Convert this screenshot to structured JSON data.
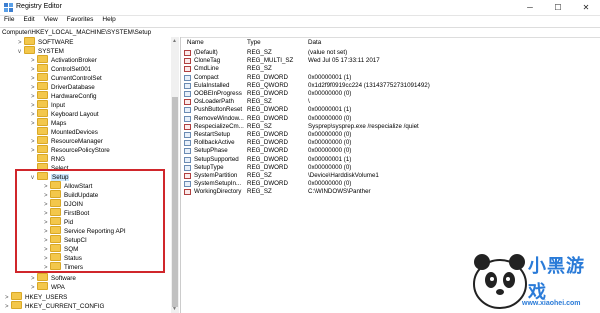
{
  "window": {
    "title": "Registry Editor",
    "minimize": "─",
    "maximize": "☐",
    "close": "✕"
  },
  "menu": [
    "File",
    "Edit",
    "View",
    "Favorites",
    "Help"
  ],
  "address": "Computer\\HKEY_LOCAL_MACHINE\\SYSTEM\\Setup",
  "tree": [
    {
      "label": "SOFTWARE",
      "exp": ">"
    },
    {
      "label": "SYSTEM",
      "exp": "v"
    },
    {
      "label": "ActivationBroker",
      "exp": ">"
    },
    {
      "label": "ControlSet001",
      "exp": ">"
    },
    {
      "label": "CurrentControlSet",
      "exp": ">"
    },
    {
      "label": "DriverDatabase",
      "exp": ">"
    },
    {
      "label": "HardwareConfig",
      "exp": ">"
    },
    {
      "label": "Input",
      "exp": ">"
    },
    {
      "label": "Keyboard Layout",
      "exp": ">"
    },
    {
      "label": "Maps",
      "exp": ">"
    },
    {
      "label": "MountedDevices",
      "exp": ""
    },
    {
      "label": "ResourceManager",
      "exp": ">"
    },
    {
      "label": "ResourcePolicyStore",
      "exp": ">"
    },
    {
      "label": "RNG",
      "exp": ""
    },
    {
      "label": "Select",
      "exp": ""
    },
    {
      "label": "Setup",
      "exp": "v"
    },
    {
      "label": "AllowStart",
      "exp": ">"
    },
    {
      "label": "BuildUpdate",
      "exp": ">"
    },
    {
      "label": "DJOIN",
      "exp": ">"
    },
    {
      "label": "FirstBoot",
      "exp": ">"
    },
    {
      "label": "Pid",
      "exp": ">"
    },
    {
      "label": "Service Reporting API",
      "exp": ">"
    },
    {
      "label": "SetupCI",
      "exp": ">"
    },
    {
      "label": "SQM",
      "exp": ">"
    },
    {
      "label": "Status",
      "exp": ">"
    },
    {
      "label": "Timers",
      "exp": ">"
    },
    {
      "label": "Software",
      "exp": ">"
    },
    {
      "label": "WPA",
      "exp": ">"
    },
    {
      "label": "HKEY_USERS",
      "exp": ">"
    },
    {
      "label": "HKEY_CURRENT_CONFIG",
      "exp": ">"
    }
  ],
  "columns": {
    "name": "Name",
    "type": "Type",
    "data": "Data"
  },
  "values": [
    {
      "name": "(Default)",
      "type": "REG_SZ",
      "data": "(value not set)",
      "icon": "ab"
    },
    {
      "name": "CloneTag",
      "type": "REG_MULTI_SZ",
      "data": "Wed Jul 05 17:33:11 2017",
      "icon": "ab"
    },
    {
      "name": "CmdLine",
      "type": "REG_SZ",
      "data": "",
      "icon": "ab"
    },
    {
      "name": "Compact",
      "type": "REG_DWORD",
      "data": "0x00000001 (1)",
      "icon": "bin"
    },
    {
      "name": "EulaInstalled",
      "type": "REG_QWORD",
      "data": "0x1d2f9f0919cc224 (131437752731091492)",
      "icon": "bin"
    },
    {
      "name": "OOBEInProgress",
      "type": "REG_DWORD",
      "data": "0x00000000 (0)",
      "icon": "bin"
    },
    {
      "name": "OsLoaderPath",
      "type": "REG_SZ",
      "data": "\\",
      "icon": "ab"
    },
    {
      "name": "PushButtonReset",
      "type": "REG_DWORD",
      "data": "0x00000001 (1)",
      "icon": "bin"
    },
    {
      "name": "RemoveWindow...",
      "type": "REG_DWORD",
      "data": "0x00000000 (0)",
      "icon": "bin"
    },
    {
      "name": "RespecializeCm...",
      "type": "REG_SZ",
      "data": "Sysprep\\sysprep.exe /respecialize /quiet",
      "icon": "ab"
    },
    {
      "name": "RestartSetup",
      "type": "REG_DWORD",
      "data": "0x00000000 (0)",
      "icon": "bin"
    },
    {
      "name": "RollbackActive",
      "type": "REG_DWORD",
      "data": "0x00000000 (0)",
      "icon": "bin"
    },
    {
      "name": "SetupPhase",
      "type": "REG_DWORD",
      "data": "0x00000000 (0)",
      "icon": "bin"
    },
    {
      "name": "SetupSupported",
      "type": "REG_DWORD",
      "data": "0x00000001 (1)",
      "icon": "bin"
    },
    {
      "name": "SetupType",
      "type": "REG_DWORD",
      "data": "0x00000000 (0)",
      "icon": "bin"
    },
    {
      "name": "SystemPartition",
      "type": "REG_SZ",
      "data": "\\Device\\HarddiskVolume1",
      "icon": "ab"
    },
    {
      "name": "SystemSetupIn...",
      "type": "REG_DWORD",
      "data": "0x00000000 (0)",
      "icon": "bin"
    },
    {
      "name": "WorkingDirectory",
      "type": "REG_SZ",
      "data": "C:\\WINDOWS\\Panther",
      "icon": "ab"
    }
  ],
  "watermark": {
    "brand": "小黑游戏",
    "url": "www.xiaohei.com"
  }
}
